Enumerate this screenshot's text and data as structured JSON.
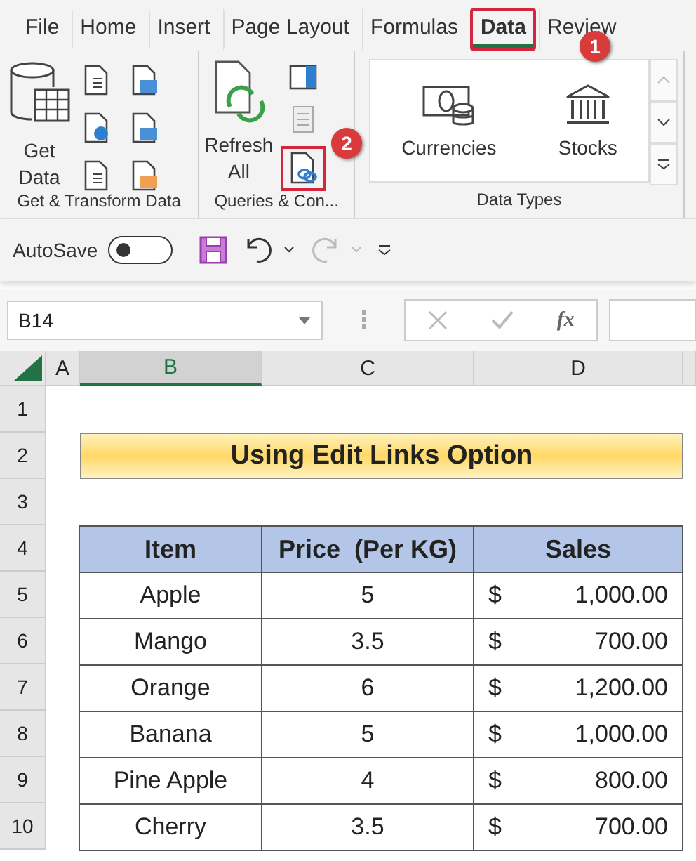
{
  "tabs": [
    {
      "label": "File",
      "selected": false,
      "highlighted": false
    },
    {
      "label": "Home",
      "selected": false,
      "highlighted": false
    },
    {
      "label": "Insert",
      "selected": false,
      "highlighted": false
    },
    {
      "label": "Page Layout",
      "selected": false,
      "highlighted": false
    },
    {
      "label": "Formulas",
      "selected": false,
      "highlighted": false
    },
    {
      "label": "Data",
      "selected": true,
      "highlighted": true
    },
    {
      "label": "Review",
      "selected": false,
      "highlighted": false
    }
  ],
  "ribbon": {
    "get_transform": {
      "get_data": "Get Data",
      "label": "Get & Transform Data"
    },
    "queries": {
      "refresh_all": "Refresh All",
      "edit_links_highlighted": true,
      "label": "Queries & Con..."
    },
    "data_types": {
      "items": [
        "Currencies",
        "Stocks"
      ],
      "label": "Data Types"
    }
  },
  "callouts": [
    {
      "number": "1"
    },
    {
      "number": "2"
    }
  ],
  "quick_access": {
    "autosave_label": "AutoSave",
    "autosave_on": false
  },
  "formula_bar": {
    "name_box": "B14",
    "fx": "fx"
  },
  "sheet": {
    "columns": [
      {
        "label": "A",
        "selected": false
      },
      {
        "label": "B",
        "selected": true
      },
      {
        "label": "C",
        "selected": false
      },
      {
        "label": "D",
        "selected": false
      }
    ],
    "row_numbers": [
      "1",
      "2",
      "3",
      "4",
      "5",
      "6",
      "7",
      "8",
      "9",
      "10"
    ],
    "title": "Using Edit Links Option",
    "headers": [
      "Item",
      "Price  (Per KG)",
      "Sales"
    ],
    "rows": [
      {
        "item": "Apple",
        "price": "5",
        "currency": "$",
        "amount": "1,000.00"
      },
      {
        "item": "Mango",
        "price": "3.5",
        "currency": "$",
        "amount": "700.00"
      },
      {
        "item": "Orange",
        "price": "6",
        "currency": "$",
        "amount": "1,200.00"
      },
      {
        "item": "Banana",
        "price": "5",
        "currency": "$",
        "amount": "1,000.00"
      },
      {
        "item": "Pine Apple",
        "price": "4",
        "currency": "$",
        "amount": "800.00"
      },
      {
        "item": "Cherry",
        "price": "3.5",
        "currency": "$",
        "amount": "700.00"
      }
    ]
  }
}
